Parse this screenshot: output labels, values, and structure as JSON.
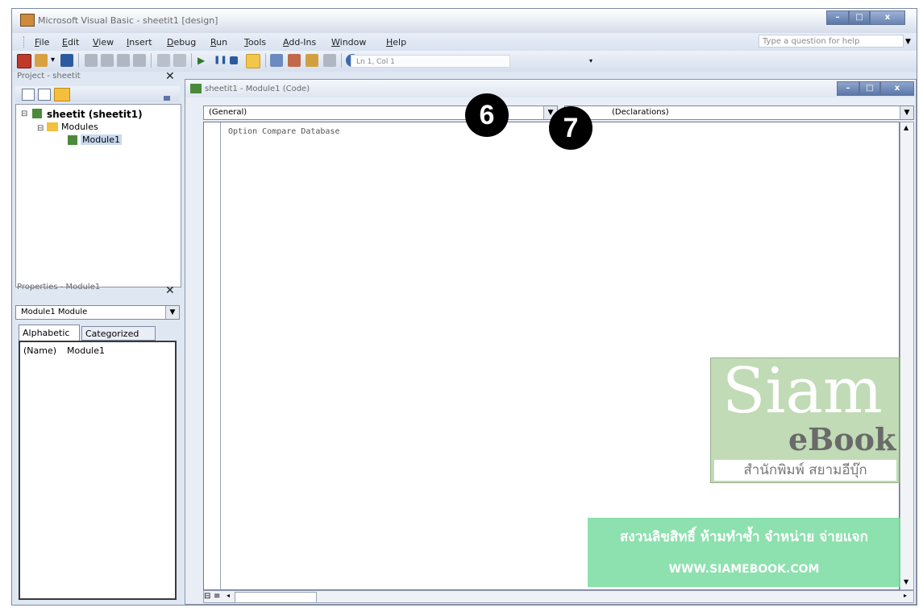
{
  "window": {
    "title": "Microsoft Visual Basic - sheetit1 [design]"
  },
  "menu": [
    "File",
    "Edit",
    "View",
    "Insert",
    "Debug",
    "Run",
    "Tools",
    "Add-Ins",
    "Window",
    "Help"
  ],
  "help_box": "Type a question for help",
  "toolbar": {
    "position_text": "Ln 1, Col 1"
  },
  "project_pane": {
    "title": "Project - sheetit",
    "tree": {
      "root": "sheetit (sheetit1)",
      "folder": "Modules",
      "module": "Module1"
    }
  },
  "properties_pane": {
    "title": "Properties - Module1",
    "object_select": "Module1 Module",
    "tabs": [
      "Alphabetic",
      "Categorized"
    ],
    "rows": [
      {
        "name": "(Name)",
        "value": "Module1"
      }
    ]
  },
  "code_window": {
    "title": "sheetit1 - Module1 (Code)",
    "object_dropdown": "(General)",
    "proc_dropdown": "(Declarations)",
    "code": "Option Compare Database"
  },
  "callouts": [
    "6",
    "7"
  ],
  "watermark": {
    "brand_big": "Siam",
    "brand_small": "eBook",
    "publisher": "สำนักพิมพ์ สยามอีบุ๊ก",
    "copyright": "สงวนลิขสิทธิ์ ห้ามทำซ้ำ จำหน่าย จ่ายแจก",
    "url": "WWW.SIAMEBOOK.COM"
  },
  "colors": {
    "accent": "#5a77a8",
    "watermark_green": "#8cbe78"
  }
}
